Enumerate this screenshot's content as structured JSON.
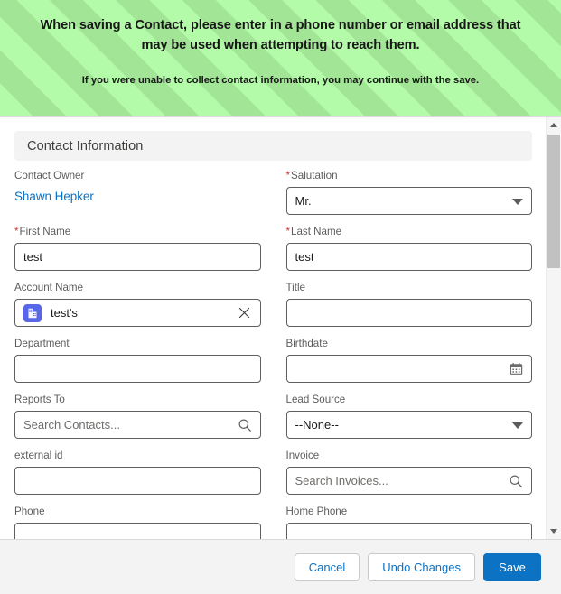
{
  "banner": {
    "main_message": "When saving a Contact, please enter in a phone number or email address that may be used when attempting to reach them.",
    "sub_message": "If you were unable to collect contact information, you may continue with the save.",
    "background_color": "#b3fba8",
    "stripe_color": "#a2e596"
  },
  "section": {
    "title": "Contact Information"
  },
  "fields": {
    "contact_owner": {
      "label": "Contact Owner",
      "value": "Shawn Hepker",
      "link_color": "#0b72c4"
    },
    "salutation": {
      "label": "Salutation",
      "required": true,
      "value": "Mr.",
      "icon": "chevron-down-icon"
    },
    "first_name": {
      "label": "First Name",
      "required": true,
      "value": "test"
    },
    "last_name": {
      "label": "Last Name",
      "required": true,
      "value": "test"
    },
    "account_name": {
      "label": "Account Name",
      "value": "test's",
      "icon": "account-icon",
      "clear_icon": "close-icon",
      "icon_color": "#5867e8"
    },
    "title": {
      "label": "Title",
      "value": ""
    },
    "department": {
      "label": "Department",
      "value": ""
    },
    "birthdate": {
      "label": "Birthdate",
      "value": "",
      "icon": "calendar-icon"
    },
    "reports_to": {
      "label": "Reports To",
      "value": "",
      "placeholder": "Search Contacts...",
      "icon": "search-icon"
    },
    "lead_source": {
      "label": "Lead Source",
      "value": "--None--",
      "icon": "chevron-down-icon"
    },
    "external_id": {
      "label": "external id",
      "value": ""
    },
    "invoice": {
      "label": "Invoice",
      "value": "",
      "placeholder": "Search Invoices...",
      "icon": "search-icon"
    },
    "phone": {
      "label": "Phone",
      "value": ""
    },
    "home_phone": {
      "label": "Home Phone",
      "value": ""
    }
  },
  "footer": {
    "cancel_label": "Cancel",
    "undo_label": "Undo Changes",
    "save_label": "Save",
    "brand_color": "#0b72c4"
  }
}
